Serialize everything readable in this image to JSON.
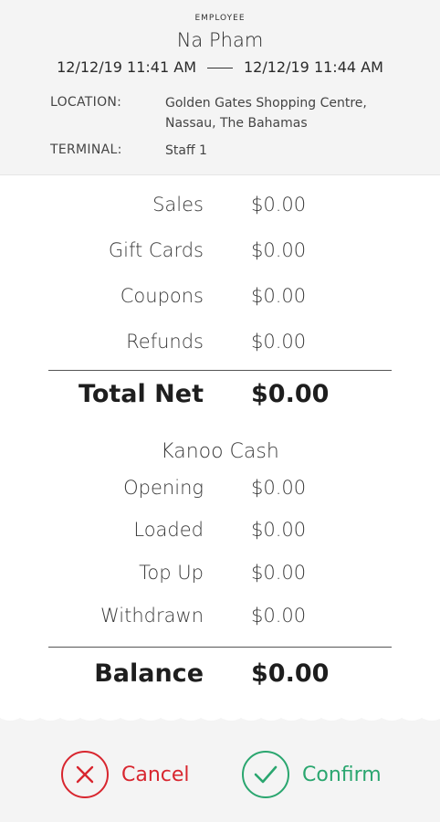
{
  "header": {
    "employee_label": "EMPLOYEE",
    "employee_name": "Na Pham",
    "start_time": "12/12/19 11:41 AM",
    "end_time": "12/12/19 11:44 AM",
    "location_label": "LOCATION:",
    "location_line1": "Golden Gates Shopping Centre,",
    "location_line2": "Nassau, The Bahamas",
    "terminal_label": "TERMINAL:",
    "terminal_value": "Staff 1"
  },
  "summary": {
    "rows": [
      {
        "label": "Sales",
        "value": "$0.00"
      },
      {
        "label": "Gift Cards",
        "value": "$0.00"
      },
      {
        "label": "Coupons",
        "value": "$0.00"
      },
      {
        "label": "Refunds",
        "value": "$0.00"
      }
    ],
    "total_label": "Total Net",
    "total_value": "$0.00"
  },
  "kanoo": {
    "title": "Kanoo Cash",
    "rows": [
      {
        "label": "Opening",
        "value": "$0.00"
      },
      {
        "label": "Loaded",
        "value": "$0.00"
      },
      {
        "label": "Top Up",
        "value": "$0.00"
      },
      {
        "label": "Withdrawn",
        "value": "$0.00"
      }
    ],
    "balance_label": "Balance",
    "balance_value": "$0.00"
  },
  "footer": {
    "cancel_label": "Cancel",
    "confirm_label": "Confirm",
    "cancel_icon": "x-circle-icon",
    "confirm_icon": "check-circle-icon",
    "cancel_color": "#d8262f",
    "confirm_color": "#2aa66f"
  }
}
